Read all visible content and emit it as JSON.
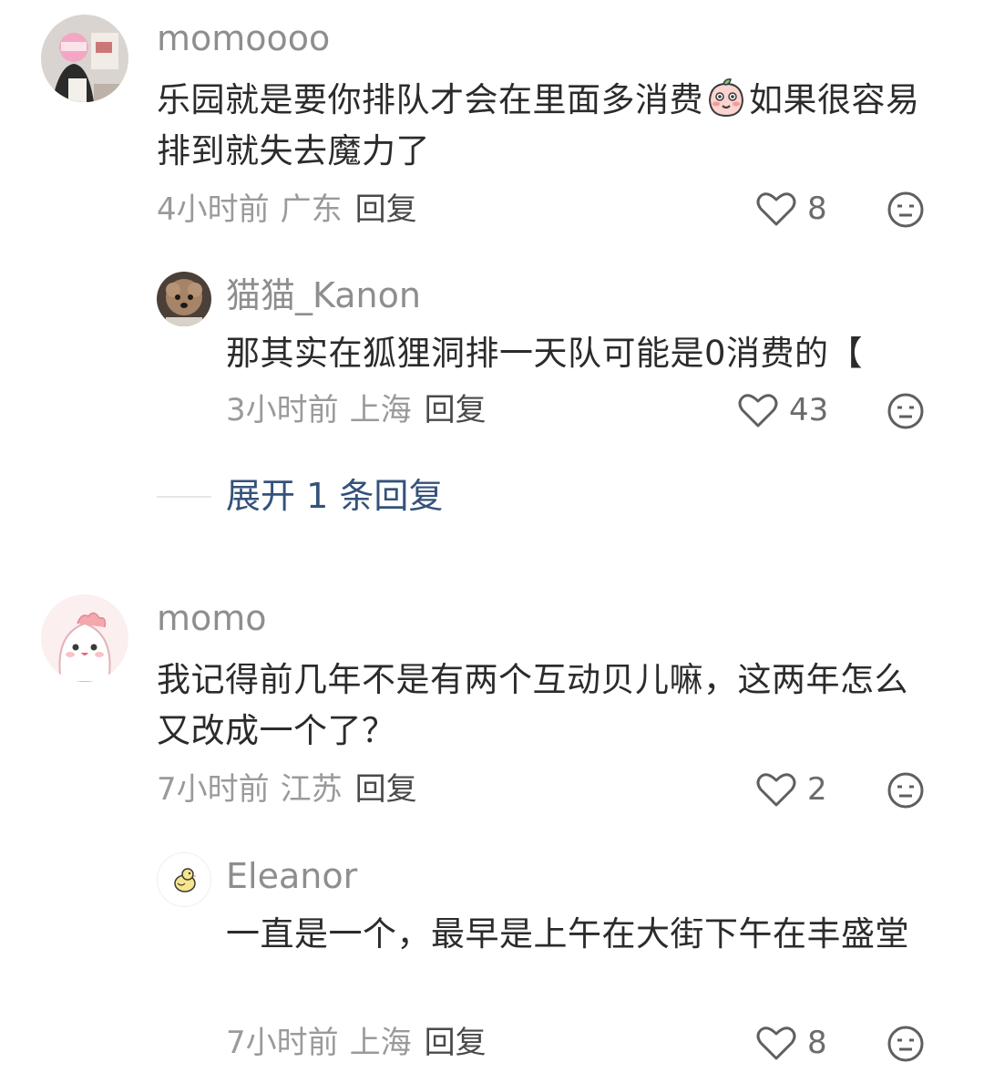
{
  "comments": [
    {
      "user": "momoooo",
      "text_before_emoji": "乐园就是要你排队才会在里面多消费",
      "text_after_emoji": "如果很容易排到就失去魔力了",
      "time": "4小时前",
      "location": "广东",
      "reply_label": "回复",
      "likes": "8",
      "replies": [
        {
          "user": "猫猫_Kanon",
          "text": "那其实在狐狸洞排一天队可能是0消费的【",
          "time": "3小时前",
          "location": "上海",
          "reply_label": "回复",
          "likes": "43"
        }
      ],
      "expand_label": "展开 1 条回复"
    },
    {
      "user": "momo",
      "text": "我记得前几年不是有两个互动贝儿嘛，这两年怎么又改成一个了？",
      "time": "7小时前",
      "location": "江苏",
      "reply_label": "回复",
      "likes": "2",
      "replies": [
        {
          "user": "Eleanor",
          "text": "一直是一个，最早是上午在大街下午在丰盛堂",
          "time": "7小时前",
          "location": "上海",
          "reply_label": "回复",
          "likes": "8"
        }
      ]
    }
  ]
}
